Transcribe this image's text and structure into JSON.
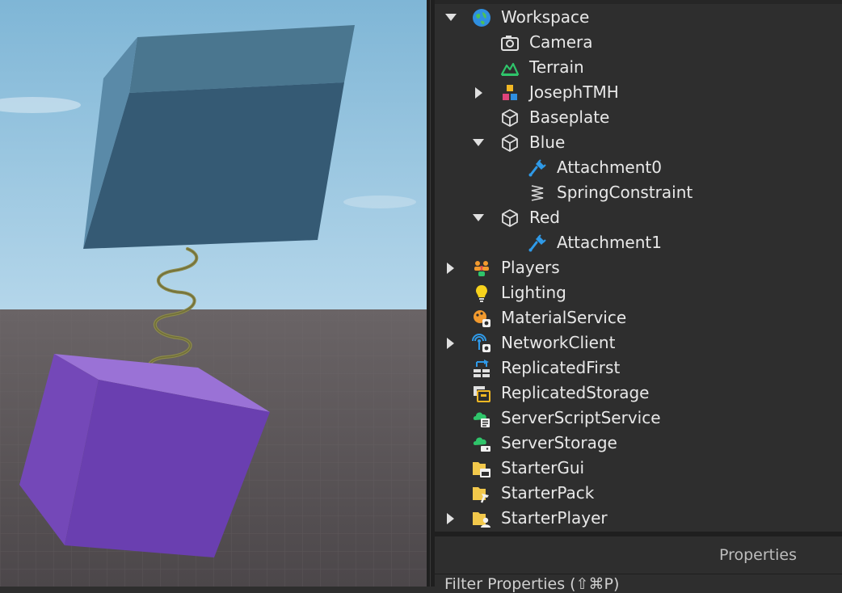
{
  "viewport": {
    "sky_color": "#9cc7e0",
    "floor_color": "#5b5659",
    "blue_part_color": "#4e7c9a",
    "red_part_color": "#7f52c4",
    "spring_color": "#8c8a4a"
  },
  "explorer": {
    "items": [
      {
        "label": "Workspace",
        "icon": "workspace-globe-icon",
        "arrow": "expanded"
      },
      {
        "label": "Camera",
        "icon": "camera-icon",
        "arrow": "none"
      },
      {
        "label": "Terrain",
        "icon": "terrain-icon",
        "arrow": "none"
      },
      {
        "label": "JosephTMH",
        "icon": "model-blocks-icon",
        "arrow": "collapsed"
      },
      {
        "label": "Baseplate",
        "icon": "part-cube-icon",
        "arrow": "none"
      },
      {
        "label": "Blue",
        "icon": "part-cube-icon",
        "arrow": "expanded"
      },
      {
        "label": "Attachment0",
        "icon": "attachment-plug-icon",
        "arrow": "none"
      },
      {
        "label": "SpringConstraint",
        "icon": "spring-icon",
        "arrow": "none"
      },
      {
        "label": "Red",
        "icon": "part-cube-icon",
        "arrow": "expanded"
      },
      {
        "label": "Attachment1",
        "icon": "attachment-plug-icon",
        "arrow": "none"
      },
      {
        "label": "Players",
        "icon": "players-icon",
        "arrow": "collapsed"
      },
      {
        "label": "Lighting",
        "icon": "lightbulb-icon",
        "arrow": "none"
      },
      {
        "label": "MaterialService",
        "icon": "material-service-icon",
        "arrow": "none"
      },
      {
        "label": "NetworkClient",
        "icon": "network-client-icon",
        "arrow": "collapsed"
      },
      {
        "label": "ReplicatedFirst",
        "icon": "replicated-first-icon",
        "arrow": "none"
      },
      {
        "label": "ReplicatedStorage",
        "icon": "replicated-storage-icon",
        "arrow": "none"
      },
      {
        "label": "ServerScriptService",
        "icon": "server-script-service-icon",
        "arrow": "none"
      },
      {
        "label": "ServerStorage",
        "icon": "server-storage-icon",
        "arrow": "none"
      },
      {
        "label": "StarterGui",
        "icon": "starter-gui-icon",
        "arrow": "none"
      },
      {
        "label": "StarterPack",
        "icon": "starter-pack-icon",
        "arrow": "none"
      },
      {
        "label": "StarterPlayer",
        "icon": "starter-player-icon",
        "arrow": "collapsed"
      }
    ]
  },
  "properties": {
    "title": "Properties",
    "filter_placeholder": "Filter Properties (⇧⌘P)"
  }
}
